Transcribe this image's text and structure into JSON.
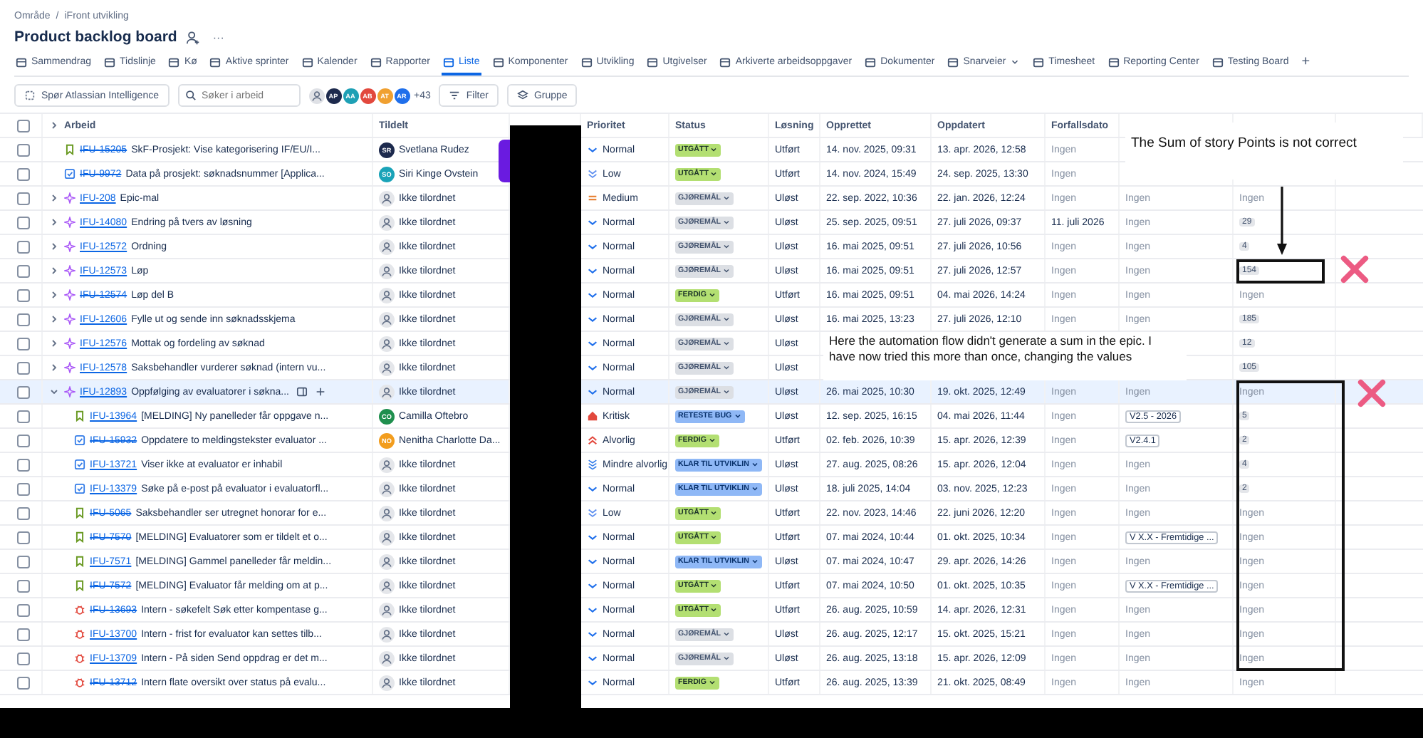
{
  "breadcrumb": {
    "items": [
      "Område",
      "iFront utvikling"
    ],
    "separator": "/"
  },
  "title": "Product backlog board",
  "more_label": "···",
  "tabs": [
    {
      "label": "Sammendrag",
      "selected": false,
      "menu": false
    },
    {
      "label": "Tidslinje",
      "selected": false,
      "menu": false
    },
    {
      "label": "Kø",
      "selected": false,
      "menu": false
    },
    {
      "label": "Aktive sprinter",
      "selected": false,
      "menu": false
    },
    {
      "label": "Kalender",
      "selected": false,
      "menu": false
    },
    {
      "label": "Rapporter",
      "selected": false,
      "menu": false
    },
    {
      "label": "Liste",
      "selected": true,
      "menu": false
    },
    {
      "label": "Komponenter",
      "selected": false,
      "menu": false
    },
    {
      "label": "Utvikling",
      "selected": false,
      "menu": false
    },
    {
      "label": "Utgivelser",
      "selected": false,
      "menu": false
    },
    {
      "label": "Arkiverte arbeidsoppgaver",
      "selected": false,
      "menu": false
    },
    {
      "label": "Dokumenter",
      "selected": false,
      "menu": false
    },
    {
      "label": "Snarveier",
      "selected": false,
      "menu": true
    },
    {
      "label": "Timesheet",
      "selected": false,
      "menu": false
    },
    {
      "label": "Reporting Center",
      "selected": false,
      "menu": false
    },
    {
      "label": "Testing Board",
      "selected": false,
      "menu": false
    }
  ],
  "add_tab_label": "+",
  "toolbar": {
    "ai_button": "Spør Atlassian Intelligence",
    "search_placeholder": "Søker i arbeid",
    "people": [
      {
        "initials": "AP",
        "color": "#1d2a4d"
      },
      {
        "initials": "AA",
        "color": "#1ea0b5"
      },
      {
        "initials": "AB",
        "color": "#e2483d"
      },
      {
        "initials": "AT",
        "color": "#f0a030"
      },
      {
        "initials": "AR",
        "color": "#1f6feb"
      }
    ],
    "more_people": "+43",
    "filter": "Filter",
    "group": "Gruppe"
  },
  "table": {
    "select_all_checked": false,
    "columns": [
      "Arbeid",
      "Tildelt",
      "Prioritet",
      "Status",
      "Løsning",
      "Opprettet",
      "Oppdatert",
      "Forfallsdato"
    ],
    "rows": [
      {
        "key": "IFU-15205",
        "summary": "SkF-Prosjekt: Vise kategorisering IF/EU/I...",
        "kind": "story",
        "checked": false,
        "resolved": true,
        "selected": false,
        "assignee": {
          "name": "Svetlana Rudez",
          "initials": "SR",
          "color": "#1d2a4d"
        },
        "priority": {
          "label": "Normal",
          "kind": "normal"
        },
        "status": {
          "label": "UTGÅTT",
          "kind": "done"
        },
        "resolution": "Utført",
        "created": "14. nov. 2025, 09:31",
        "updated": "13. apr. 2026, 12:58",
        "due": {
          "text": "Ingen",
          "kind": "none"
        }
      },
      {
        "key": "IFU-9972",
        "summary": "Data på prosjekt: søknadsnummer [Applica...",
        "kind": "task",
        "checked": false,
        "resolved": true,
        "selected": false,
        "assignee": {
          "name": "Siri Kinge Ovstein",
          "initials": "SO",
          "color": "#1aa3b8"
        },
        "priority": {
          "label": "Low",
          "kind": "low"
        },
        "status": {
          "label": "UTGÅTT",
          "kind": "done"
        },
        "resolution": "Utført",
        "created": "14. nov. 2024, 15:49",
        "updated": "24. sep. 2025, 13:30",
        "due": {
          "text": "Ingen",
          "kind": "none"
        }
      },
      {
        "key": "IFU-208",
        "summary": "Epic-mal",
        "kind": "epic",
        "checked": false,
        "resolved": false,
        "expanded": false,
        "selected": false,
        "assignee": {
          "name": "Ikke tilordnet"
        },
        "priority": {
          "label": "Medium",
          "kind": "medium"
        },
        "status": {
          "label": "GJØREMÅL",
          "kind": "todo"
        },
        "resolution": "Uløst",
        "created": "22. sep. 2022, 10:36",
        "updated": "22. jan. 2026, 12:24",
        "due": {
          "text": "Ingen",
          "kind": "none"
        },
        "column_10": {
          "text": "Ingen",
          "kind": "none"
        },
        "column_11": {
          "text": "Ingen",
          "kind": "none"
        }
      },
      {
        "key": "IFU-14080",
        "summary": "Endring på tvers av løsning",
        "kind": "epic",
        "checked": false,
        "resolved": false,
        "expanded": false,
        "selected": false,
        "assignee": {
          "name": "Ikke tilordnet"
        },
        "priority": {
          "label": "Normal",
          "kind": "normal"
        },
        "status": {
          "label": "GJØREMÅL",
          "kind": "todo"
        },
        "resolution": "Uløst",
        "created": "25. sep. 2025, 09:51",
        "updated": "27. juli 2026, 09:37",
        "due": {
          "text": "11. juli 2026",
          "kind": "date"
        },
        "column_10": {
          "text": "Ingen",
          "kind": "none"
        },
        "column_11": {
          "text": "29",
          "kind": "points"
        }
      },
      {
        "key": "IFU-12572",
        "summary": "Ordning",
        "kind": "epic",
        "checked": false,
        "resolved": false,
        "expanded": false,
        "selected": false,
        "assignee": {
          "name": "Ikke tilordnet"
        },
        "priority": {
          "label": "Normal",
          "kind": "normal"
        },
        "status": {
          "label": "GJØREMÅL",
          "kind": "todo"
        },
        "resolution": "Uløst",
        "created": "16. mai 2025, 09:51",
        "updated": "27. juli 2026, 10:56",
        "due": {
          "text": "Ingen",
          "kind": "none"
        },
        "column_10": {
          "text": "Ingen",
          "kind": "none"
        },
        "column_11": {
          "text": "4",
          "kind": "points"
        }
      },
      {
        "key": "IFU-12573",
        "summary": "Løp",
        "kind": "epic",
        "checked": false,
        "resolved": false,
        "expanded": false,
        "selected": false,
        "assignee": {
          "name": "Ikke tilordnet"
        },
        "priority": {
          "label": "Normal",
          "kind": "normal"
        },
        "status": {
          "label": "GJØREMÅL",
          "kind": "todo"
        },
        "resolution": "Uløst",
        "created": "16. mai 2025, 09:51",
        "updated": "27. juli 2026, 12:57",
        "due": {
          "text": "Ingen",
          "kind": "none"
        },
        "column_10": {
          "text": "Ingen",
          "kind": "none"
        },
        "column_11": {
          "text": "154",
          "kind": "points"
        }
      },
      {
        "key": "IFU-12574",
        "summary": "Løp del B",
        "kind": "epic",
        "checked": false,
        "resolved": true,
        "expanded": false,
        "selected": false,
        "assignee": {
          "name": "Ikke tilordnet"
        },
        "priority": {
          "label": "Normal",
          "kind": "normal"
        },
        "status": {
          "label": "FERDIG",
          "kind": "done"
        },
        "resolution": "Utført",
        "created": "16. mai 2025, 09:51",
        "updated": "04. mai 2026, 14:24",
        "due": {
          "text": "Ingen",
          "kind": "none"
        },
        "column_10": {
          "text": "Ingen",
          "kind": "none"
        },
        "column_11": {
          "text": "Ingen",
          "kind": "none"
        }
      },
      {
        "key": "IFU-12606",
        "summary": "Fylle ut og sende inn søknadsskjema",
        "kind": "epic",
        "checked": false,
        "resolved": false,
        "expanded": false,
        "selected": false,
        "assignee": {
          "name": "Ikke tilordnet"
        },
        "priority": {
          "label": "Normal",
          "kind": "normal"
        },
        "status": {
          "label": "GJØREMÅL",
          "kind": "todo"
        },
        "resolution": "Uløst",
        "created": "16. mai 2025, 13:23",
        "updated": "27. juli 2026, 12:10",
        "due": {
          "text": "Ingen",
          "kind": "none"
        },
        "column_10": {
          "text": "Ingen",
          "kind": "none"
        },
        "column_11": {
          "text": "185",
          "kind": "points"
        }
      },
      {
        "key": "IFU-12576",
        "summary": "Mottak og fordeling av søknad",
        "kind": "epic",
        "checked": false,
        "resolved": false,
        "expanded": false,
        "selected": false,
        "assignee": {
          "name": "Ikke tilordnet"
        },
        "priority": {
          "label": "Normal",
          "kind": "normal"
        },
        "status": {
          "label": "GJØREMÅL",
          "kind": "todo"
        },
        "resolution": "Uløst",
        "column_11": {
          "text": "12",
          "kind": "points"
        }
      },
      {
        "key": "IFU-12578",
        "summary": "Saksbehandler vurderer søknad (intern vu...",
        "kind": "epic",
        "checked": false,
        "resolved": false,
        "expanded": false,
        "selected": false,
        "assignee": {
          "name": "Ikke tilordnet"
        },
        "priority": {
          "label": "Normal",
          "kind": "normal"
        },
        "status": {
          "label": "GJØREMÅL",
          "kind": "todo"
        },
        "resolution": "Uløst",
        "column_11": {
          "text": "105",
          "kind": "points"
        }
      },
      {
        "key": "IFU-12893",
        "summary": "Oppfølging av evaluatorer i søkna...",
        "kind": "epic",
        "checked": false,
        "resolved": false,
        "expanded": true,
        "selected": true,
        "assignee": {
          "name": "Ikke tilordnet"
        },
        "priority": {
          "label": "Normal",
          "kind": "normal"
        },
        "status": {
          "label": "GJØREMÅL",
          "kind": "todo"
        },
        "resolution": "Uløst",
        "created": "26. mai 2025, 10:30",
        "updated": "19. okt. 2025, 12:49",
        "due": {
          "text": "Ingen",
          "kind": "none"
        },
        "column_10": {
          "text": "Ingen",
          "kind": "none"
        },
        "column_11": {
          "text": "Ingen",
          "kind": "none"
        },
        "children": [
          {
            "key": "IFU-13964",
            "summary": "[MELDING] Ny panelleder får oppgave n...",
            "kind": "story",
            "checked": false,
            "resolved": false,
            "selected": false,
            "assignee": {
              "name": "Camilla Oftebro",
              "initials": "CO",
              "color": "#1f8f4e"
            },
            "priority": {
              "label": "Kritisk",
              "kind": "critical"
            },
            "status": {
              "label": "RETESTE BUG",
              "kind": "progress"
            },
            "resolution": "Uløst",
            "created": "12. sep. 2025, 16:15",
            "updated": "04. mai 2026, 11:44",
            "due": {
              "text": "Ingen",
              "kind": "none"
            },
            "column_10": {
              "text": "V2.5 - 2026",
              "kind": "tag"
            },
            "column_11": {
              "text": "5",
              "kind": "points"
            }
          },
          {
            "key": "IFU-15932",
            "summary": "Oppdatere to meldingstekster evaluator ...",
            "kind": "task",
            "checked": false,
            "resolved": true,
            "selected": false,
            "assignee": {
              "name": "Nenitha Charlotte Da...",
              "initials": "NO",
              "color": "#f29d1e"
            },
            "priority": {
              "label": "Alvorlig",
              "kind": "major"
            },
            "status": {
              "label": "FERDIG",
              "kind": "done"
            },
            "resolution": "Utført",
            "created": "02. feb. 2026, 10:39",
            "updated": "15. apr. 2026, 12:39",
            "due": {
              "text": "Ingen",
              "kind": "none"
            },
            "column_10": {
              "text": "V2.4.1",
              "kind": "tag"
            },
            "column_11": {
              "text": "2",
              "kind": "points"
            }
          },
          {
            "key": "IFU-13721",
            "summary": "Viser ikke at evaluator er inhabil",
            "kind": "task",
            "checked": false,
            "resolved": false,
            "selected": false,
            "assignee": {
              "name": "Ikke tilordnet"
            },
            "priority": {
              "label": "Mindre alvorlig",
              "kind": "minor"
            },
            "status": {
              "label": "KLAR TIL UTVIKLIN",
              "kind": "progress"
            },
            "resolution": "Uløst",
            "created": "27. aug. 2025, 08:26",
            "updated": "15. apr. 2026, 12:04",
            "due": {
              "text": "Ingen",
              "kind": "none"
            },
            "column_10": {
              "text": "Ingen",
              "kind": "none"
            },
            "column_11": {
              "text": "4",
              "kind": "points"
            }
          },
          {
            "key": "IFU-13379",
            "summary": "Søke på e-post på evaluator i evaluatorfl...",
            "kind": "task",
            "checked": false,
            "resolved": false,
            "selected": false,
            "assignee": {
              "name": "Ikke tilordnet"
            },
            "priority": {
              "label": "Normal",
              "kind": "normal"
            },
            "status": {
              "label": "KLAR TIL UTVIKLIN",
              "kind": "progress"
            },
            "resolution": "Uløst",
            "created": "18. juli 2025, 14:04",
            "updated": "03. nov. 2025, 12:23",
            "due": {
              "text": "Ingen",
              "kind": "none"
            },
            "column_10": {
              "text": "Ingen",
              "kind": "none"
            },
            "column_11": {
              "text": "2",
              "kind": "points"
            }
          },
          {
            "key": "IFU-5065",
            "summary": "Saksbehandler ser utregnet honorar for e...",
            "kind": "story",
            "checked": false,
            "resolved": true,
            "selected": false,
            "assignee": {
              "name": "Ikke tilordnet"
            },
            "priority": {
              "label": "Low",
              "kind": "low"
            },
            "status": {
              "label": "UTGÅTT",
              "kind": "done"
            },
            "resolution": "Utført",
            "created": "22. nov. 2023, 14:46",
            "updated": "22. juni 2026, 12:20",
            "due": {
              "text": "Ingen",
              "kind": "none"
            },
            "column_10": {
              "text": "Ingen",
              "kind": "none"
            },
            "column_11": {
              "text": "Ingen",
              "kind": "none"
            }
          },
          {
            "key": "IFU-7570",
            "summary": "[MELDING] Evaluatorer som er tildelt et o...",
            "kind": "story",
            "checked": false,
            "resolved": true,
            "selected": false,
            "assignee": {
              "name": "Ikke tilordnet"
            },
            "priority": {
              "label": "Normal",
              "kind": "normal"
            },
            "status": {
              "label": "UTGÅTT",
              "kind": "done"
            },
            "resolution": "Utført",
            "created": "07. mai 2024, 10:44",
            "updated": "01. okt. 2025, 10:34",
            "due": {
              "text": "Ingen",
              "kind": "none"
            },
            "column_10": {
              "text": "V X.X - Fremtidige ...",
              "kind": "tag"
            },
            "column_11": {
              "text": "Ingen",
              "kind": "none"
            }
          },
          {
            "key": "IFU-7571",
            "summary": "[MELDING] Gammel panelleder får meldin...",
            "kind": "story",
            "checked": false,
            "resolved": false,
            "selected": false,
            "assignee": {
              "name": "Ikke tilordnet"
            },
            "priority": {
              "label": "Normal",
              "kind": "normal"
            },
            "status": {
              "label": "KLAR TIL UTVIKLIN",
              "kind": "progress"
            },
            "resolution": "Uløst",
            "created": "07. mai 2024, 10:47",
            "updated": "29. apr. 2026, 14:26",
            "due": {
              "text": "Ingen",
              "kind": "none"
            },
            "column_10": {
              "text": "Ingen",
              "kind": "none"
            },
            "column_11": {
              "text": "Ingen",
              "kind": "none"
            }
          },
          {
            "key": "IFU-7572",
            "summary": "[MELDING] Evaluator får melding om at p...",
            "kind": "story",
            "checked": false,
            "resolved": true,
            "selected": false,
            "assignee": {
              "name": "Ikke tilordnet"
            },
            "priority": {
              "label": "Normal",
              "kind": "normal"
            },
            "status": {
              "label": "UTGÅTT",
              "kind": "done"
            },
            "resolution": "Utført",
            "created": "07. mai 2024, 10:50",
            "updated": "01. okt. 2025, 10:35",
            "due": {
              "text": "Ingen",
              "kind": "none"
            },
            "column_10": {
              "text": "V X.X - Fremtidige ...",
              "kind": "tag"
            },
            "column_11": {
              "text": "Ingen",
              "kind": "none"
            }
          },
          {
            "key": "IFU-13693",
            "summary": "Intern - søkefelt Søk etter kompentase g...",
            "kind": "bug",
            "checked": false,
            "resolved": true,
            "selected": false,
            "assignee": {
              "name": "Ikke tilordnet"
            },
            "priority": {
              "label": "Normal",
              "kind": "normal"
            },
            "status": {
              "label": "UTGÅTT",
              "kind": "done"
            },
            "resolution": "Utført",
            "created": "26. aug. 2025, 10:59",
            "updated": "14. apr. 2026, 12:31",
            "due": {
              "text": "Ingen",
              "kind": "none"
            },
            "column_10": {
              "text": "Ingen",
              "kind": "none"
            },
            "column_11": {
              "text": "Ingen",
              "kind": "none"
            }
          },
          {
            "key": "IFU-13700",
            "summary": "Intern - frist for evaluator kan settes tilb...",
            "kind": "bug",
            "checked": false,
            "resolved": false,
            "selected": false,
            "assignee": {
              "name": "Ikke tilordnet"
            },
            "priority": {
              "label": "Normal",
              "kind": "normal"
            },
            "status": {
              "label": "GJØREMÅL",
              "kind": "todo"
            },
            "resolution": "Uløst",
            "created": "26. aug. 2025, 12:17",
            "updated": "15. okt. 2025, 15:21",
            "due": {
              "text": "Ingen",
              "kind": "none"
            },
            "column_10": {
              "text": "Ingen",
              "kind": "none"
            },
            "column_11": {
              "text": "Ingen",
              "kind": "none"
            }
          },
          {
            "key": "IFU-13709",
            "summary": "Intern - På siden Send oppdrag er det m...",
            "kind": "bug",
            "checked": false,
            "resolved": false,
            "selected": false,
            "assignee": {
              "name": "Ikke tilordnet"
            },
            "priority": {
              "label": "Normal",
              "kind": "normal"
            },
            "status": {
              "label": "GJØREMÅL",
              "kind": "todo"
            },
            "resolution": "Uløst",
            "created": "26. aug. 2025, 13:18",
            "updated": "15. apr. 2026, 12:09",
            "due": {
              "text": "Ingen",
              "kind": "none"
            },
            "column_10": {
              "text": "Ingen",
              "kind": "none"
            },
            "column_11": {
              "text": "Ingen",
              "kind": "none"
            }
          },
          {
            "key": "IFU-13712",
            "summary": "Intern flate oversikt over status på evalu...",
            "kind": "bug",
            "checked": false,
            "resolved": true,
            "selected": false,
            "assignee": {
              "name": "Ikke tilordnet"
            },
            "priority": {
              "label": "Normal",
              "kind": "normal"
            },
            "status": {
              "label": "FERDIG",
              "kind": "done"
            },
            "resolution": "Utført",
            "created": "26. aug. 2025, 13:39",
            "updated": "21. okt. 2025, 08:49",
            "due": {
              "text": "Ingen",
              "kind": "none"
            },
            "column_10": {
              "text": "Ingen",
              "kind": "none"
            },
            "column_11": {
              "text": "Ingen",
              "kind": "none"
            }
          }
        ]
      }
    ]
  },
  "annotations": [
    {
      "text": "The Sum of story Points is not correct"
    },
    {
      "text": "Here the automation flow didn't generate a sum in the epic. I have now tried this more than once, changing the values"
    }
  ]
}
